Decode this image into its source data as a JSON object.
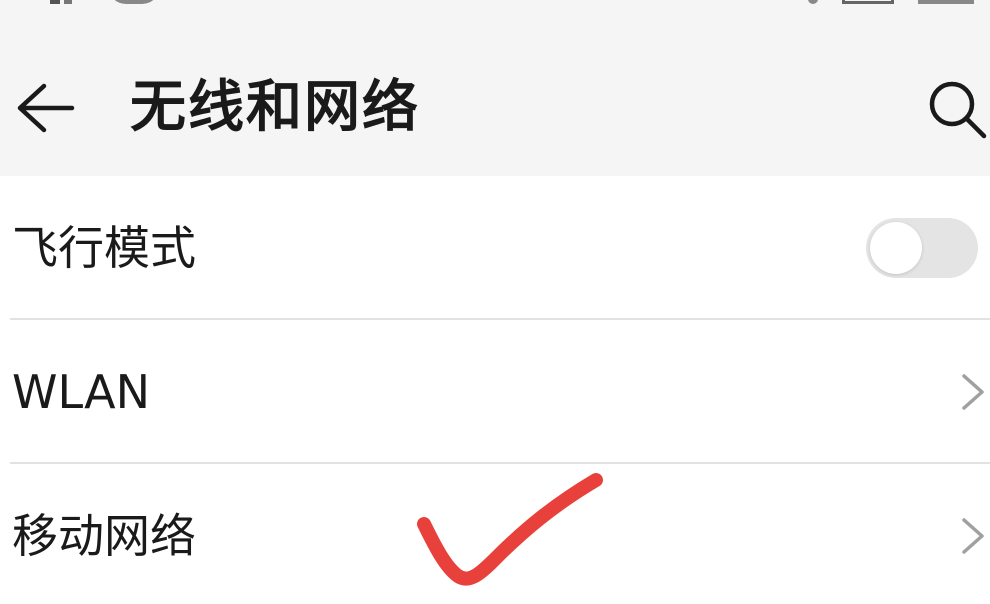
{
  "header": {
    "title": "无线和网络",
    "back_icon": "arrow-left-icon",
    "search_icon": "search-icon"
  },
  "settings": {
    "items": [
      {
        "label": "飞行模式",
        "control": "toggle",
        "toggle_on": false
      },
      {
        "label": "WLAN",
        "control": "chevron"
      },
      {
        "label": "移动网络",
        "control": "chevron"
      }
    ]
  },
  "colors": {
    "header_bg": "#f5f5f5",
    "list_bg": "#ffffff",
    "text": "#1a1a1a",
    "divider": "#e2e2e2",
    "toggle_off": "#e4e4e4",
    "chevron": "#a0a0a0",
    "annotation_check": "#e8403a"
  }
}
